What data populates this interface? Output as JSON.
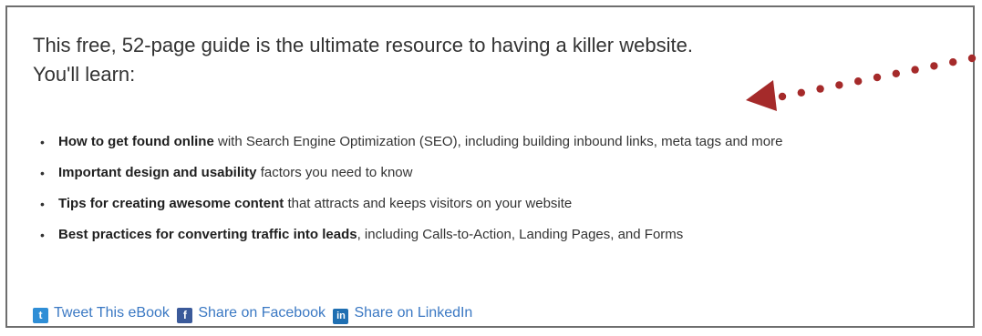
{
  "intro": {
    "line1": "This free, 52-page guide is the ultimate resource to having a killer website.",
    "line2": "You'll learn:"
  },
  "features": [
    {
      "bold": "How to get found online",
      "rest": " with Search Engine Optimization (SEO), including building inbound links, meta tags and more"
    },
    {
      "bold": "Important design and usability",
      "rest": " factors you need to know"
    },
    {
      "bold": "Tips for creating awesome content",
      "rest": " that attracts and keeps visitors on your website"
    },
    {
      "bold": "Best practices for converting traffic into leads",
      "rest": ", including Calls-to-Action, Landing Pages, and Forms"
    }
  ],
  "bullet_glyph": "•",
  "share": {
    "twitter_label": "Tweet This eBook",
    "facebook_label": "Share on Facebook",
    "linkedin_label": "Share on LinkedIn",
    "twitter_glyph": "t",
    "facebook_glyph": "f",
    "linkedin_glyph": "in"
  },
  "colors": {
    "arrow": "#a52a2a",
    "link": "#3a78c3",
    "text": "#333333"
  },
  "icons": {
    "annotation": "dotted-arrow-icon"
  }
}
